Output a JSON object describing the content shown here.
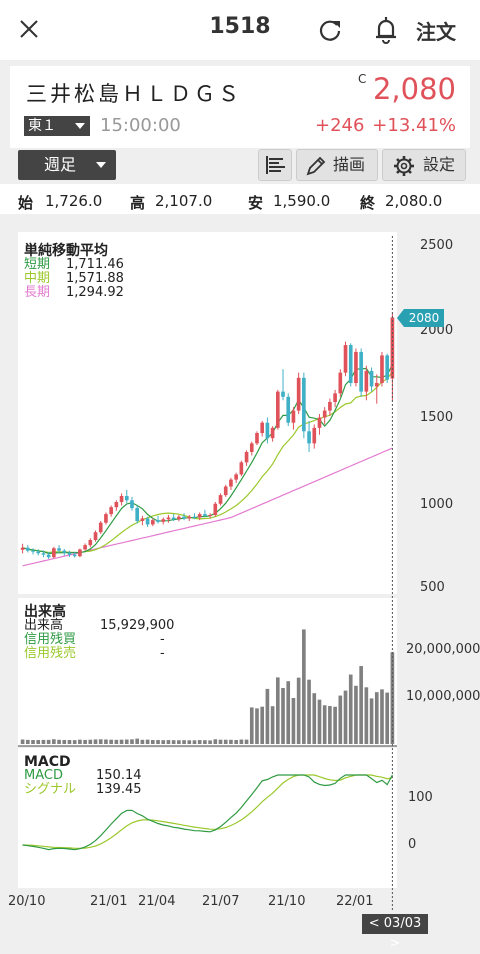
{
  "header": {
    "code": "1518",
    "order_label": "注文"
  },
  "stock": {
    "name": "三井松島ＨＬＤＧＳ",
    "c_mark": "C",
    "price": "2,080",
    "market": "東１",
    "time": "15:00:00",
    "change": "+246",
    "change_pct": "+13.41%"
  },
  "toolbar": {
    "period": "週足",
    "draw_label": "描画",
    "settings_label": "設定"
  },
  "ohlc": {
    "open_label": "始",
    "open": "1,726.0",
    "high_label": "高",
    "high": "2,107.0",
    "low_label": "安",
    "low": "1,590.0",
    "close_label": "終",
    "close": "2,080.0"
  },
  "price_panel": {
    "title": "単純移動平均",
    "rows": [
      {
        "label": "短期",
        "value": "1,711.46",
        "color": "#2e9a43"
      },
      {
        "label": "中期",
        "value": "1,571.88",
        "color": "#9bc82b"
      },
      {
        "label": "長期",
        "value": "1,294.92",
        "color": "#e47ad0"
      }
    ],
    "y_ticks": [
      "2500",
      "2000",
      "1500",
      "1000",
      "500"
    ],
    "last_price_tag": "2080"
  },
  "volume_panel": {
    "title": "出来高",
    "rows": [
      {
        "label": "出来高",
        "value": "15,929,900",
        "color": "#222222"
      },
      {
        "label": "信用残買",
        "value": "-",
        "color": "#2e9a43"
      },
      {
        "label": "信用残売",
        "value": "-",
        "color": "#9bc82b"
      }
    ],
    "y_ticks": [
      "20,000,000",
      "10,000,000"
    ]
  },
  "macd_panel": {
    "title": "MACD",
    "rows": [
      {
        "label": "MACD",
        "value": "150.14",
        "color": "#2e9a43"
      },
      {
        "label": "シグナル",
        "value": "139.45",
        "color": "#9bc82b"
      }
    ],
    "y_ticks": [
      "100",
      "0"
    ]
  },
  "x_ticks": [
    "20/10",
    "21/01",
    "21/04",
    "21/07",
    "21/10",
    "22/01"
  ],
  "cursor_date": "< 03/03 >",
  "colors": {
    "up": "#e0525a",
    "down": "#3fb0c6",
    "accent_price": "#e0525a",
    "tag": "#2aa0b3"
  },
  "chart_data": {
    "type": "candlestick",
    "period": "weekly",
    "ylim": [
      500,
      2500
    ],
    "x_range": [
      "2020-10",
      "2022-03-03"
    ],
    "ohlc": [
      [
        733,
        768,
        712,
        745
      ],
      [
        745,
        760,
        718,
        728
      ],
      [
        728,
        742,
        706,
        722
      ],
      [
        722,
        736,
        700,
        713
      ],
      [
        713,
        730,
        690,
        705
      ],
      [
        705,
        720,
        680,
        690
      ],
      [
        690,
        750,
        685,
        742
      ],
      [
        742,
        760,
        715,
        728
      ],
      [
        728,
        738,
        700,
        716
      ],
      [
        716,
        728,
        692,
        705
      ],
      [
        705,
        720,
        688,
        696
      ],
      [
        696,
        740,
        690,
        735
      ],
      [
        735,
        770,
        728,
        760
      ],
      [
        760,
        800,
        748,
        790
      ],
      [
        790,
        845,
        780,
        835
      ],
      [
        835,
        900,
        825,
        890
      ],
      [
        890,
        950,
        880,
        940
      ],
      [
        940,
        990,
        925,
        980
      ],
      [
        980,
        1020,
        960,
        1010
      ],
      [
        1010,
        1060,
        990,
        1045
      ],
      [
        1045,
        1080,
        1005,
        1020
      ],
      [
        1020,
        1040,
        960,
        975
      ],
      [
        975,
        990,
        885,
        900
      ],
      [
        900,
        930,
        875,
        915
      ],
      [
        915,
        925,
        865,
        880
      ],
      [
        880,
        915,
        870,
        905
      ],
      [
        905,
        930,
        885,
        895
      ],
      [
        895,
        920,
        880,
        910
      ],
      [
        910,
        935,
        890,
        920
      ],
      [
        920,
        940,
        900,
        910
      ],
      [
        910,
        935,
        898,
        925
      ],
      [
        925,
        945,
        905,
        915
      ],
      [
        915,
        935,
        900,
        925
      ],
      [
        925,
        945,
        910,
        920
      ],
      [
        920,
        950,
        905,
        940
      ],
      [
        940,
        965,
        925,
        930
      ],
      [
        930,
        945,
        915,
        935
      ],
      [
        935,
        1010,
        925,
        1000
      ],
      [
        1000,
        1060,
        990,
        1050
      ],
      [
        1050,
        1110,
        1040,
        1100
      ],
      [
        1100,
        1150,
        1080,
        1140
      ],
      [
        1140,
        1180,
        1120,
        1170
      ],
      [
        1170,
        1250,
        1160,
        1240
      ],
      [
        1240,
        1310,
        1220,
        1300
      ],
      [
        1300,
        1360,
        1280,
        1350
      ],
      [
        1350,
        1420,
        1340,
        1410
      ],
      [
        1410,
        1480,
        1390,
        1470
      ],
      [
        1470,
        1500,
        1350,
        1380
      ],
      [
        1380,
        1450,
        1360,
        1440
      ],
      [
        1440,
        1660,
        1430,
        1650
      ],
      [
        1650,
        1780,
        1600,
        1620
      ],
      [
        1620,
        1640,
        1450,
        1470
      ],
      [
        1470,
        1560,
        1430,
        1540
      ],
      [
        1540,
        1760,
        1520,
        1730
      ],
      [
        1730,
        1760,
        1380,
        1420
      ],
      [
        1420,
        1480,
        1300,
        1350
      ],
      [
        1350,
        1460,
        1320,
        1440
      ],
      [
        1440,
        1520,
        1400,
        1500
      ],
      [
        1500,
        1560,
        1460,
        1540
      ],
      [
        1540,
        1610,
        1510,
        1590
      ],
      [
        1590,
        1660,
        1560,
        1640
      ],
      [
        1640,
        1780,
        1620,
        1760
      ],
      [
        1760,
        1940,
        1740,
        1920
      ],
      [
        1920,
        1930,
        1680,
        1700
      ],
      [
        1700,
        1900,
        1680,
        1880
      ],
      [
        1880,
        1900,
        1620,
        1650
      ],
      [
        1650,
        1800,
        1600,
        1770
      ],
      [
        1770,
        1790,
        1650,
        1680
      ],
      [
        1680,
        1750,
        1580,
        1700
      ],
      [
        1700,
        1880,
        1680,
        1860
      ],
      [
        1860,
        1870,
        1700,
        1720
      ],
      [
        1726,
        2107,
        1590,
        2080
      ]
    ],
    "ma_short_last": 1711.46,
    "ma_mid_last": 1571.88,
    "ma_long_last": 1294.92,
    "volume_last": 15929900,
    "volume_ylim": [
      0,
      25000000
    ],
    "macd_last": 150.14,
    "signal_last": 139.45
  }
}
